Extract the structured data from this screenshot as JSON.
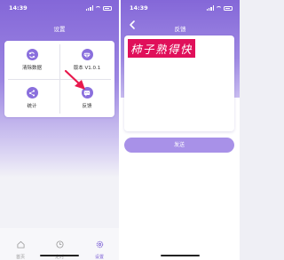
{
  "colors": {
    "accent": "#8467d8",
    "arrow": "#e8194d",
    "highlight": "#e0105a"
  },
  "left": {
    "status_time": "14:39",
    "title": "设置",
    "items": [
      {
        "label": "清除数据",
        "icon": "refresh-icon"
      },
      {
        "label": "版本 V1.0.1",
        "icon": "diamond-icon"
      },
      {
        "label": "统计",
        "icon": "share-icon"
      },
      {
        "label": "反馈",
        "icon": "message-icon"
      }
    ],
    "tabs": [
      {
        "label": "首页",
        "icon": "home-icon"
      },
      {
        "label": "定时",
        "icon": "clock-icon"
      },
      {
        "label": "设置",
        "icon": "gear-icon",
        "active": true
      }
    ]
  },
  "right": {
    "status_time": "14:39",
    "title": "反馈",
    "input_text": "柿子熟得快",
    "send_label": "发送"
  }
}
